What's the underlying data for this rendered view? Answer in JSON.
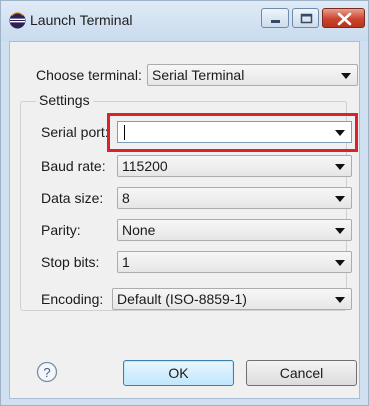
{
  "window": {
    "title": "Launch Terminal",
    "controls": [
      "minimize",
      "maximize",
      "close"
    ]
  },
  "form": {
    "choose_terminal": {
      "label": "Choose terminal:",
      "value": "Serial Terminal"
    },
    "settings": {
      "title": "Settings",
      "serial_port": {
        "label": "Serial port:",
        "value": ""
      },
      "baud_rate": {
        "label": "Baud rate:",
        "value": "115200"
      },
      "data_size": {
        "label": "Data size:",
        "value": "8"
      },
      "parity": {
        "label": "Parity:",
        "value": "None"
      },
      "stop_bits": {
        "label": "Stop bits:",
        "value": "1"
      },
      "encoding": {
        "label": "Encoding:",
        "value": "Default (ISO-8859-1)"
      }
    }
  },
  "buttons": {
    "ok": "OK",
    "cancel": "Cancel"
  },
  "icons": {
    "app": "eclipse-icon",
    "help": "help-icon",
    "dropdown": "chevron-down-icon"
  },
  "colors": {
    "highlight": "#d9222a",
    "titlebar": "#cfe0f1",
    "close_button": "#c9452d"
  }
}
